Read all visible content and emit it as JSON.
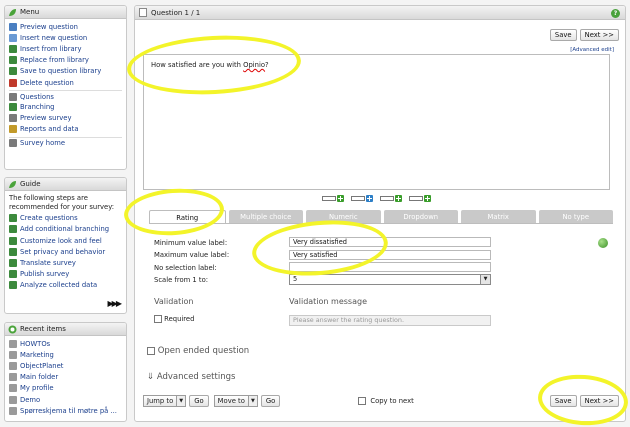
{
  "menu": {
    "title": "Menu",
    "items": [
      {
        "label": "Preview question",
        "color": "#4a7fc1"
      },
      {
        "label": "Insert new question",
        "color": "#6a9ad4"
      },
      {
        "label": "Insert from library",
        "color": "#3c8a3c"
      },
      {
        "label": "Replace from library",
        "color": "#3c8a3c"
      },
      {
        "label": "Save to question library",
        "color": "#3c8a3c"
      },
      {
        "label": "Delete question",
        "color": "#c0392b"
      },
      {
        "label": "Questions",
        "color": "#7a7a7a"
      },
      {
        "label": "Branching",
        "color": "#3c8a3c"
      },
      {
        "label": "Preview survey",
        "color": "#7a7a7a"
      },
      {
        "label": "Reports and data",
        "color": "#c29a2a"
      },
      {
        "label": "Survey home",
        "color": "#7a7a7a"
      }
    ]
  },
  "guide": {
    "title": "Guide",
    "intro": "The following steps are recommended for your survey:",
    "items": [
      {
        "label": "Create questions",
        "color": "#3c8a3c"
      },
      {
        "label": "Add conditional branching",
        "color": "#3c8a3c"
      },
      {
        "label": "Customize look and feel",
        "color": "#3c8a3c"
      },
      {
        "label": "Set privacy and behavior",
        "color": "#3c8a3c"
      },
      {
        "label": "Translate survey",
        "color": "#3c8a3c"
      },
      {
        "label": "Publish survey",
        "color": "#3c8a3c"
      },
      {
        "label": "Analyze collected data",
        "color": "#3c8a3c"
      }
    ],
    "more_icon": "double-right-arrow-icon"
  },
  "recent": {
    "title": "Recent items",
    "items": [
      {
        "label": "HOWTOs"
      },
      {
        "label": "Marketing"
      },
      {
        "label": "ObjectPlanet"
      },
      {
        "label": "Main folder"
      },
      {
        "label": "My profile"
      },
      {
        "label": "Demo"
      },
      {
        "label": "Spørreskjema til møtre på ..."
      }
    ]
  },
  "editor": {
    "title": "Question 1 / 1",
    "save_label": "Save",
    "next_label": "Next >>",
    "advanced_edit": "[Advanced edit]",
    "question_text_prefix": "How satisfied are you with ",
    "question_text_word": "Opinio",
    "question_text_suffix": "?",
    "tabs": [
      "Rating",
      "Multiple choice",
      "Numeric",
      "Dropdown",
      "Matrix",
      "No type"
    ],
    "active_tab": "Rating",
    "fields": {
      "min_label": "Minimum value label:",
      "min_value": "Very dissatisfied",
      "max_label": "Maximum value label:",
      "max_value": "Very satisfied",
      "nosel_label": "No selection label:",
      "nosel_value": "",
      "scale_label": "Scale from 1 to:",
      "scale_value": "5"
    },
    "validation": {
      "heading": "Validation",
      "message_heading": "Validation message",
      "required_label": "Required",
      "message_placeholder": "Please answer the rating question."
    },
    "open_ended_label": "Open ended question",
    "advanced_settings_label": "Advanced settings",
    "bottom": {
      "jump_to": "Jump to",
      "go": "Go",
      "move_to": "Move to",
      "copy_to_next": "Copy to next",
      "save_label": "Save",
      "next_label": "Next >>"
    }
  },
  "colors": {
    "highlight": "#f3f42a",
    "tab_inactive": "#c9c9c9",
    "link": "#1a3e8c"
  }
}
